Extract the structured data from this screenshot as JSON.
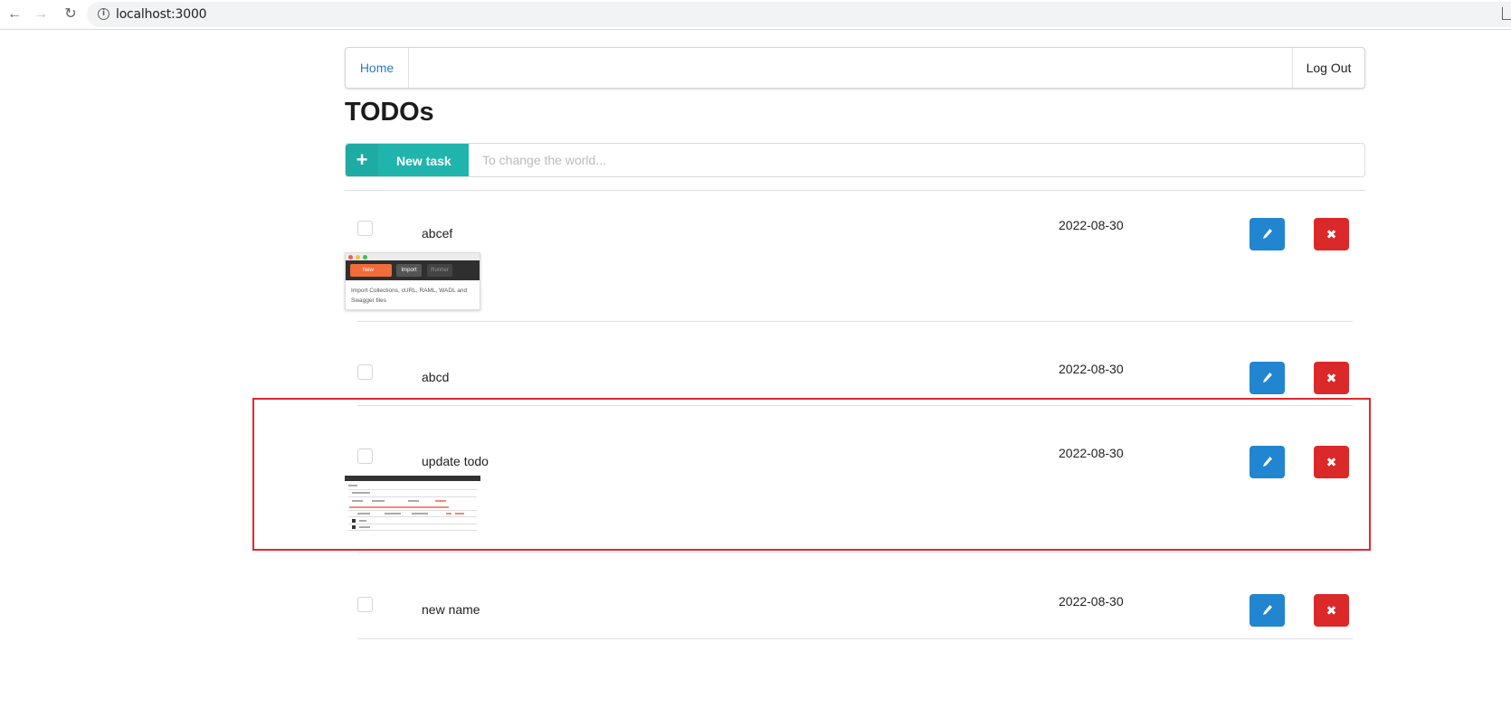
{
  "browser": {
    "url": "localhost:3000"
  },
  "nav": {
    "home": "Home",
    "logout": "Log Out"
  },
  "page": {
    "title": "TODOs"
  },
  "new_task": {
    "button_label": "New task",
    "placeholder": "To change the world..."
  },
  "todos": [
    {
      "name": "abcef",
      "date": "2022-08-30",
      "checked": false,
      "has_image": true
    },
    {
      "name": "abcd",
      "date": "2022-08-30",
      "checked": false,
      "has_image": false
    },
    {
      "name": "update todo",
      "date": "2022-08-30",
      "checked": false,
      "has_image": true,
      "highlighted": true
    },
    {
      "name": "new name",
      "date": "2022-08-30",
      "checked": false,
      "has_image": false
    }
  ],
  "thumb1": {
    "new_label": "New",
    "import_label": "Import",
    "runner_label": "Runner",
    "tip_line1": "Import Collections, cURL, RAML, WADL and",
    "tip_line2": "Swagger files"
  },
  "colors": {
    "accent": "#1fb5ac",
    "edit": "#2185d0",
    "delete": "#db2828",
    "highlight": "#e0282e",
    "link": "#2b7bc4"
  }
}
